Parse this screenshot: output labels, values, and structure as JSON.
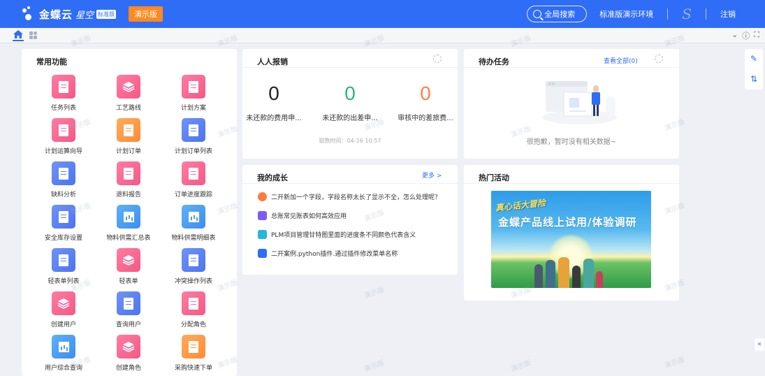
{
  "header": {
    "brand": "金蝶云",
    "product": "星空",
    "edition_badge": "标准版",
    "demo_label": "演示版",
    "search_label": "全局搜索",
    "environment": "标准版演示环境",
    "user_initial": "S",
    "logout_label": "注销"
  },
  "colors": {
    "primary": "#2f6df6",
    "accent": "#ff8a1f",
    "pink": "#f45886",
    "green": "#2bb673",
    "orange": "#ff7f4a"
  },
  "common": {
    "title": "常用功能",
    "items": [
      {
        "label": "任务列表",
        "color": "pink",
        "icon": "doc"
      },
      {
        "label": "工艺路线",
        "color": "pink",
        "icon": "layers"
      },
      {
        "label": "计划方案",
        "color": "pink",
        "icon": "doc"
      },
      {
        "label": "计划运算向导",
        "color": "pink",
        "icon": "doc"
      },
      {
        "label": "计划订单",
        "color": "orange",
        "icon": "doc"
      },
      {
        "label": "计划订单列表",
        "color": "blue",
        "icon": "doc"
      },
      {
        "label": "缺料分析",
        "color": "blue",
        "icon": "doc"
      },
      {
        "label": "退料报告",
        "color": "pink",
        "icon": "doc"
      },
      {
        "label": "订单进度跟踪",
        "color": "pink",
        "icon": "doc"
      },
      {
        "label": "安全库存设置",
        "color": "blue",
        "icon": "doc"
      },
      {
        "label": "物料供需汇总表",
        "color": "sky",
        "icon": "chart"
      },
      {
        "label": "物料供需明细表",
        "color": "sky",
        "icon": "chart"
      },
      {
        "label": "轻表单列表",
        "color": "blue",
        "icon": "doc"
      },
      {
        "label": "轻表单",
        "color": "pink",
        "icon": "layers"
      },
      {
        "label": "冲突操作列表",
        "color": "blue",
        "icon": "doc"
      },
      {
        "label": "创建用户",
        "color": "pink",
        "icon": "layers"
      },
      {
        "label": "查询用户",
        "color": "blue",
        "icon": "doc"
      },
      {
        "label": "分配角色",
        "color": "pink",
        "icon": "doc"
      },
      {
        "label": "用户综合查询",
        "color": "sky",
        "icon": "chart"
      },
      {
        "label": "创建角色",
        "color": "pink",
        "icon": "layers"
      },
      {
        "label": "采购快速下单",
        "color": "orange",
        "icon": "doc"
      }
    ]
  },
  "reimburse": {
    "title": "人人报销",
    "stats": [
      {
        "value": "0",
        "label": "未还款的费用申...",
        "color": "#222222"
      },
      {
        "value": "0",
        "label": "未还款的出差申...",
        "color": "#2bb673"
      },
      {
        "value": "0",
        "label": "审核中的差旅费...",
        "color": "#ff7f4a"
      }
    ],
    "fetch_time": "取数时间：04-16 10:57"
  },
  "todo": {
    "title": "待办任务",
    "view_all": "查看全部(0)",
    "empty_text": "很抱歉，暂时没有相关数据~"
  },
  "growth": {
    "title": "我的成长",
    "more": "更多 >",
    "items": [
      {
        "text": "二开新加一个字段，字段名称太长了显示不全，怎么处理呢？",
        "icon": "chat-icon",
        "color": "#ff7a3d"
      },
      {
        "text": "总账常见账表如何高效应用",
        "icon": "document-icon",
        "color": "#7b5cf0"
      },
      {
        "text": "PLM项目管理甘特图里面的进度条不同颜色代表含义",
        "icon": "video-icon",
        "color": "#27b6d8"
      },
      {
        "text": "二开案例.python插件.通过插件修改菜单名称",
        "icon": "speaker-icon",
        "color": "#2f6df6"
      }
    ]
  },
  "hot": {
    "title": "热门活动",
    "banner_tag": "真心话大冒险",
    "banner_title": "金蝶产品线上试用/体验调研"
  },
  "watermark": "演示版"
}
